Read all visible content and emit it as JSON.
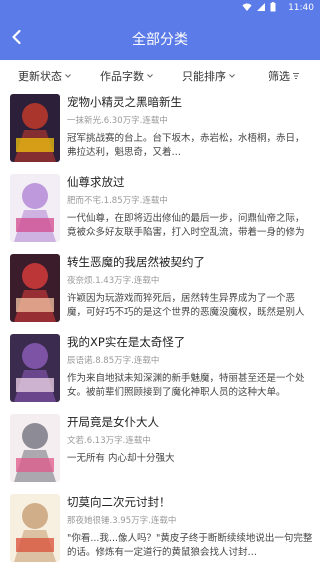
{
  "status_bar": {
    "time": "11:40",
    "icons": [
      "wifi-icon",
      "signal-icon",
      "battery-icon"
    ]
  },
  "header": {
    "title": "全部分类",
    "back_icon": "chevron-left-icon"
  },
  "filters": [
    {
      "label": "更新状态",
      "icon": "chevron-down-icon"
    },
    {
      "label": "作品字数",
      "icon": "chevron-down-icon"
    },
    {
      "label": "只能排序",
      "icon": "chevron-down-icon"
    },
    {
      "label": "筛选",
      "icon": "filter-icon"
    }
  ],
  "books": [
    {
      "title": "宠物小精灵之黑暗新生",
      "meta": "一抹新光.6.30万字.连载中",
      "desc": "冠军挑战赛的台上。台下坂木，赤岩松，水梧桐，赤日，弗拉达利，魁思奇，又着…",
      "cover_colors": [
        "#2b1f3a",
        "#c0392b",
        "#f1c40f"
      ]
    },
    {
      "title": "仙尊求放过",
      "meta": "肥而不宅.1.85万字.连载中",
      "desc": "一代仙尊，在即将迈出修仙的最后一步，问鼎仙帝之际，竟被众多好友联手陷害，打入时空乱流，带着一身的修为降临到…",
      "cover_colors": [
        "#f3eef6",
        "#b48ad6",
        "#d14b8f"
      ]
    },
    {
      "title": "转生恶魔的我居然被契约了",
      "meta": "夜奈烦.1.43万字.连载中",
      "desc": "许颖因为玩游戏而猝死后，居然转生异界成为了一个恶魔，可好巧不巧的是这个世界的恶魔没魔权，既然是别人当宠物一样的…",
      "cover_colors": [
        "#3a1c2b",
        "#d43b3b",
        "#f5c6a5"
      ]
    },
    {
      "title": "我的XP实在是太奇怪了",
      "meta": "辰语诺.8.85万字.连载中",
      "desc": "作为来自地狱未知深渊的新手魅魔，特丽甚至还是一个处女。被前辈们照顾接到了魔化神职人员的这种大单。",
      "cover_colors": [
        "#3b2b4f",
        "#8a5ab5",
        "#f0d7e8"
      ]
    },
    {
      "title": "开局竟是女仆大人",
      "meta": "文若.6.13万字.连载中",
      "desc": "一无所有\n内心却十分强大",
      "cover_colors": [
        "#f5eef0",
        "#7a7a86",
        "#e05a8a"
      ]
    },
    {
      "title": "切莫向二次元讨封！",
      "meta": "那夜她很锤.3.95万字.连载中",
      "desc": "\"你看...我...像人吗？\"黄皮子终于断断续续地说出一句完整的话。修炼有一定道行的黄鼠狼会找人讨封…",
      "cover_colors": [
        "#f7efe0",
        "#c9a27a",
        "#d94f3a"
      ]
    }
  ]
}
